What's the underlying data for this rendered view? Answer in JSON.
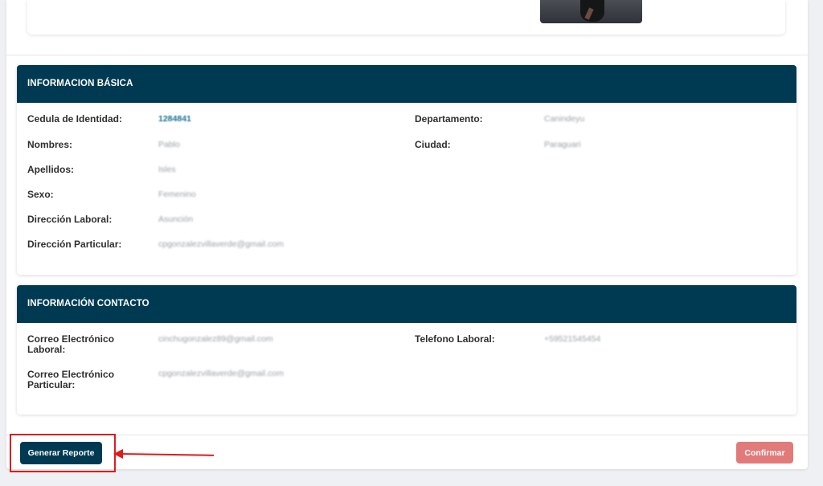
{
  "basic": {
    "title": "INFORMACION BÁSICA",
    "fields": {
      "cedula": {
        "label": "Cedula de Identidad:",
        "value": "1284841"
      },
      "nombres": {
        "label": "Nombres:",
        "value": "Pablo"
      },
      "apellidos": {
        "label": "Apellidos:",
        "value": "Isles"
      },
      "sexo": {
        "label": "Sexo:",
        "value": "Femenino"
      },
      "direccion_laboral": {
        "label": "Dirección Laboral:",
        "value": "Asunción"
      },
      "direccion_particular": {
        "label": "Dirección Particular:",
        "value": "cpgonzalezvillaverde@gmail.com"
      },
      "departamento": {
        "label": "Departamento:",
        "value": "Canindeyu"
      },
      "ciudad": {
        "label": "Ciudad:",
        "value": "Paraguari"
      }
    }
  },
  "contact": {
    "title": "INFORMACIÓN CONTACTO",
    "fields": {
      "correo_laboral": {
        "label_line1": "Correo Electrónico",
        "label_line2": "Laboral:",
        "value": "cinchugonzalez89@gmail.com"
      },
      "correo_particular": {
        "label_line1": "Correo Electrónico",
        "label_line2": "Particular:",
        "value": "cpgonzalezvillaverde@gmail.com"
      },
      "telefono_laboral": {
        "label": "Telefono Laboral:",
        "value": "+59521545454"
      }
    }
  },
  "footer": {
    "generate_label": "Generar Reporte",
    "confirm_label": "Confirmar",
    "annotation_color": "#e01b1b"
  },
  "colors": {
    "header_bg": "#003a52",
    "confirm_bg": "#e37a7a",
    "link_value": "#1a6f9a"
  }
}
